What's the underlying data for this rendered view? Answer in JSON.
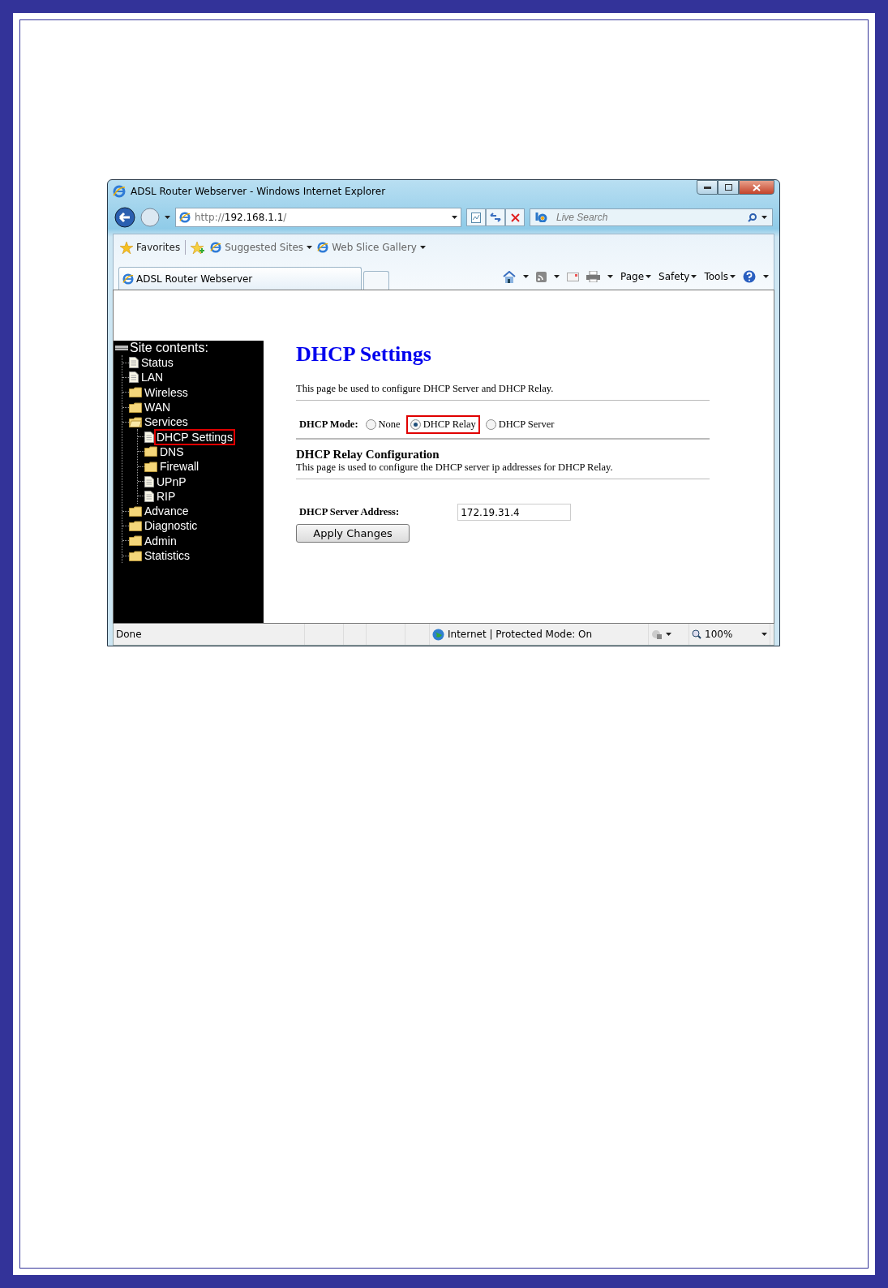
{
  "window": {
    "title": "ADSL Router Webserver - Windows Internet Explorer"
  },
  "address_bar": {
    "url_prefix": "http://",
    "url_host": "192.168.1.1",
    "url_suffix": "/"
  },
  "search": {
    "placeholder": "Live Search"
  },
  "favorites_bar": {
    "label": "Favorites",
    "links": [
      {
        "label": "Suggested Sites"
      },
      {
        "label": "Web Slice Gallery"
      }
    ]
  },
  "tabs": [
    {
      "label": "ADSL Router Webserver",
      "selected": true
    }
  ],
  "command_bar": {
    "menus": [
      "Page",
      "Safety",
      "Tools"
    ]
  },
  "sidebar": {
    "title": "Site contents:",
    "items": [
      {
        "label": "Status",
        "kind": "page",
        "selected": false
      },
      {
        "label": "LAN",
        "kind": "page",
        "selected": false
      },
      {
        "label": "Wireless",
        "kind": "folder",
        "selected": false
      },
      {
        "label": "WAN",
        "kind": "folder",
        "selected": false
      },
      {
        "label": "Services",
        "kind": "folder",
        "selected": false,
        "expanded": true,
        "children": [
          {
            "label": "DHCP Settings",
            "kind": "page",
            "selected": true
          },
          {
            "label": "DNS",
            "kind": "folder",
            "selected": false
          },
          {
            "label": "Firewall",
            "kind": "folder",
            "selected": false
          },
          {
            "label": "UPnP",
            "kind": "page",
            "selected": false
          },
          {
            "label": "RIP",
            "kind": "page",
            "selected": false
          }
        ]
      },
      {
        "label": "Advance",
        "kind": "folder",
        "selected": false
      },
      {
        "label": "Diagnostic",
        "kind": "folder",
        "selected": false
      },
      {
        "label": "Admin",
        "kind": "folder",
        "selected": false
      },
      {
        "label": "Statistics",
        "kind": "folder",
        "selected": false
      }
    ]
  },
  "main": {
    "title": "DHCP Settings",
    "description": "This page be used to configure DHCP Server and DHCP Relay.",
    "mode": {
      "label": "DHCP Mode:",
      "options": [
        {
          "label": "None",
          "selected": false,
          "highlighted": false
        },
        {
          "label": "DHCP Relay",
          "selected": true,
          "highlighted": true
        },
        {
          "label": "DHCP Server",
          "selected": false,
          "highlighted": false
        }
      ]
    },
    "section_title": "DHCP Relay Configuration",
    "section_description": "This page is used to configure the DHCP server ip addresses for DHCP Relay.",
    "field": {
      "label": "DHCP Server Address:",
      "value": "172.19.31.4"
    },
    "button": "Apply Changes"
  },
  "status_bar": {
    "text": "Done",
    "zone": "Internet | Protected Mode: On",
    "zoom": "100%"
  }
}
